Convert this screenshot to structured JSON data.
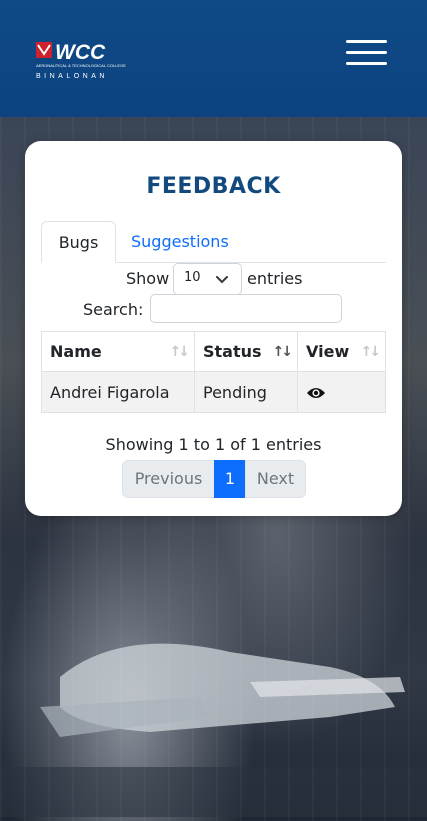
{
  "header": {
    "logo_text": "WCC",
    "logo_subtitle": "AERONAUTICAL & TECHNOLOGICAL COLLEGE",
    "logo_campus": "BINALONAN",
    "menu_icon": "hamburger-menu-icon"
  },
  "card": {
    "title": "FEEDBACK",
    "tabs": [
      {
        "label": "Bugs",
        "active": true
      },
      {
        "label": "Suggestions",
        "active": false
      }
    ],
    "length": {
      "show_label": "Show",
      "selected": "10",
      "entries_label": "entries"
    },
    "search": {
      "label": "Search:",
      "value": "",
      "placeholder": ""
    },
    "table": {
      "columns": [
        "Name",
        "Status",
        "View"
      ],
      "rows": [
        {
          "name": "Andrei Figarola",
          "status": "Pending",
          "view_icon": "eye-icon"
        }
      ]
    },
    "info": "Showing 1 to 1 of 1 entries",
    "pagination": {
      "previous": "Previous",
      "current": "1",
      "next": "Next"
    }
  },
  "colors": {
    "header_bg": "#0f4a86",
    "title": "#124a7e",
    "link": "#0d6efd",
    "active_page": "#0d6efd"
  }
}
